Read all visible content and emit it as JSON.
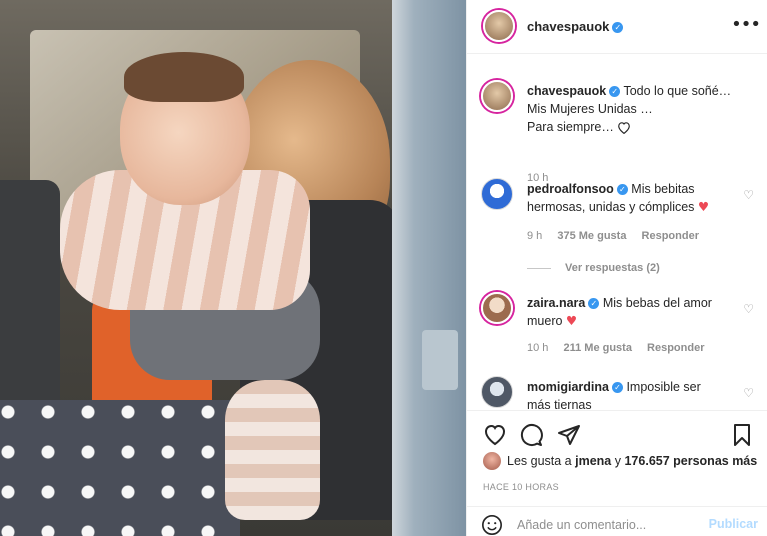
{
  "post": {
    "author": "chavespauok",
    "more_icon": "more-horizontal-icon",
    "caption_lines": [
      "Todo lo que soñé…",
      "Mis Mujeres Unidas …",
      "Para siempre…"
    ],
    "caption_time": "10 h"
  },
  "comments": [
    {
      "user": "pedroalfonsoo",
      "text_lines": [
        "Mis bebitas",
        "hermosas, unidas y cómplices"
      ],
      "time": "9 h",
      "likes": "375 Me gusta",
      "reply": "Responder",
      "view_replies": "Ver respuestas (2)"
    },
    {
      "user": "zaira.nara",
      "text_lines": [
        "Mis bebas del amor",
        "muero"
      ],
      "time": "10 h",
      "likes": "211 Me gusta",
      "reply": "Responder"
    },
    {
      "user": "momigiardina",
      "text_lines": [
        "Imposible ser",
        "más tiernas"
      ]
    }
  ],
  "likes_summary": {
    "prefix": "Les gusta a ",
    "first_user": "jmena",
    "middle": " y ",
    "count": "176.657 personas más"
  },
  "time_ago": "HACE 10 HORAS",
  "add_comment": {
    "placeholder": "Añade un comentario...",
    "publish_label": "Publicar"
  },
  "colors": {
    "verified": "#3897f0",
    "heart": "#ed4956",
    "publish_disabled": "#b3dbff",
    "story_ring": "#d6249f"
  }
}
